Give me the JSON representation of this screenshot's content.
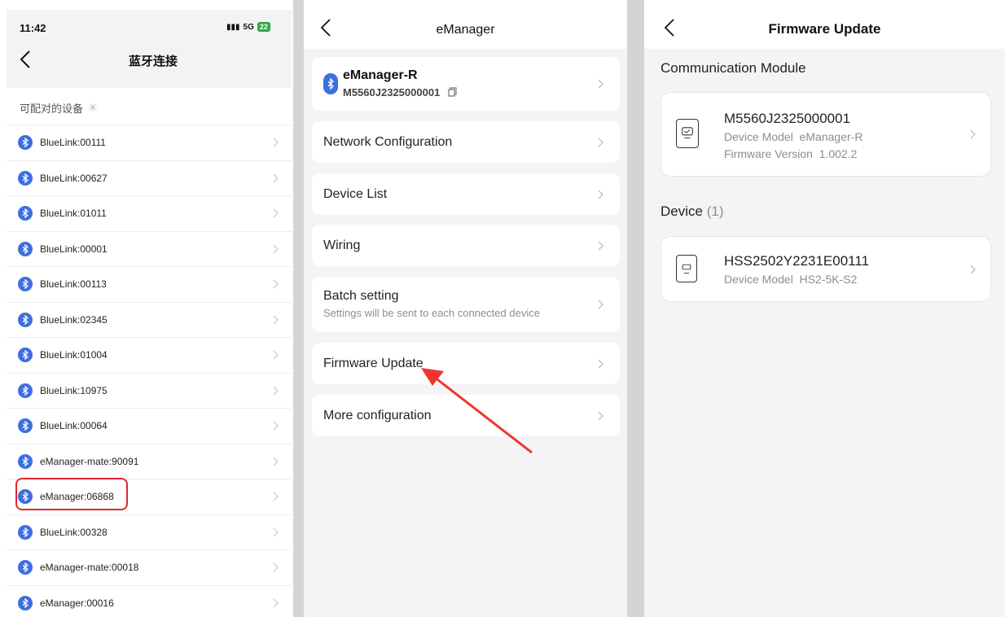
{
  "panel_bluetooth": {
    "status_time": "11:42",
    "status_network": "5G",
    "status_battery": "22",
    "title": "蓝牙连接",
    "section_label": "可配对的设备",
    "devices": [
      "BlueLink:00111",
      "BlueLink:00627",
      "BlueLink:01011",
      "BlueLink:00001",
      "BlueLink:00113",
      "BlueLink:02345",
      "BlueLink:01004",
      "BlueLink:10975",
      "BlueLink:00064",
      "eManager-mate:90091",
      "eManager:06868",
      "BlueLink:00328",
      "eManager-mate:00018",
      "eManager:00016"
    ],
    "highlight_color": "#e0262f",
    "bluetooth_color": "#3d6fe0"
  },
  "panel_emanager": {
    "title": "eManager",
    "device_card": {
      "name": "eManager-R",
      "serial": "M5560J2325000001"
    },
    "menu": {
      "network": "Network Configuration",
      "device_list": "Device List",
      "wiring": "Wiring",
      "batch": "Batch setting",
      "batch_sub": "Settings will be sent to each connected device",
      "firmware": "Firmware Update",
      "more": "More configuration"
    },
    "arrow_color": "#f0352c"
  },
  "panel_firmware": {
    "title": "Firmware Update",
    "comm_section": "Communication Module",
    "comm_module": {
      "serial": "M5560J2325000001",
      "model_label": "Device Model",
      "model": "eManager-R",
      "firmware_label": "Firmware Version",
      "firmware": "1.002.2"
    },
    "device_section": "Device",
    "device_count": "(1)",
    "device": {
      "serial": "HSS2502Y2231E00111",
      "model_label": "Device Model",
      "model": "HS2-5K-S2"
    }
  }
}
